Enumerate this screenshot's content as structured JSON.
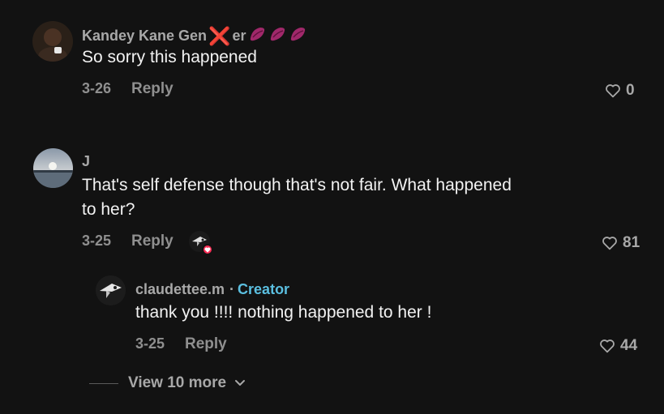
{
  "comments": [
    {
      "username_prefix": "Kandey Kane Gen",
      "username_emoji": "❌",
      "username_suffix": "er",
      "text": "So sorry this happened",
      "date": "3-26",
      "reply_label": "Reply",
      "likes": "0"
    },
    {
      "username": "J",
      "text_line1": "That's self defense though that's not fair. What happened",
      "text_line2": "to her?",
      "date": "3-25",
      "reply_label": "Reply",
      "likes": "81"
    }
  ],
  "reply": {
    "username": "claudettee.m",
    "separator": "·",
    "badge": "Creator",
    "text": "thank you !!!! nothing happened to her !",
    "date": "3-25",
    "reply_label": "Reply",
    "likes": "44"
  },
  "view_more": "View 10 more",
  "colors": {
    "background": "#121212",
    "creator_badge": "#5bbfe0",
    "like_heart_badge": "#fe2c55"
  }
}
